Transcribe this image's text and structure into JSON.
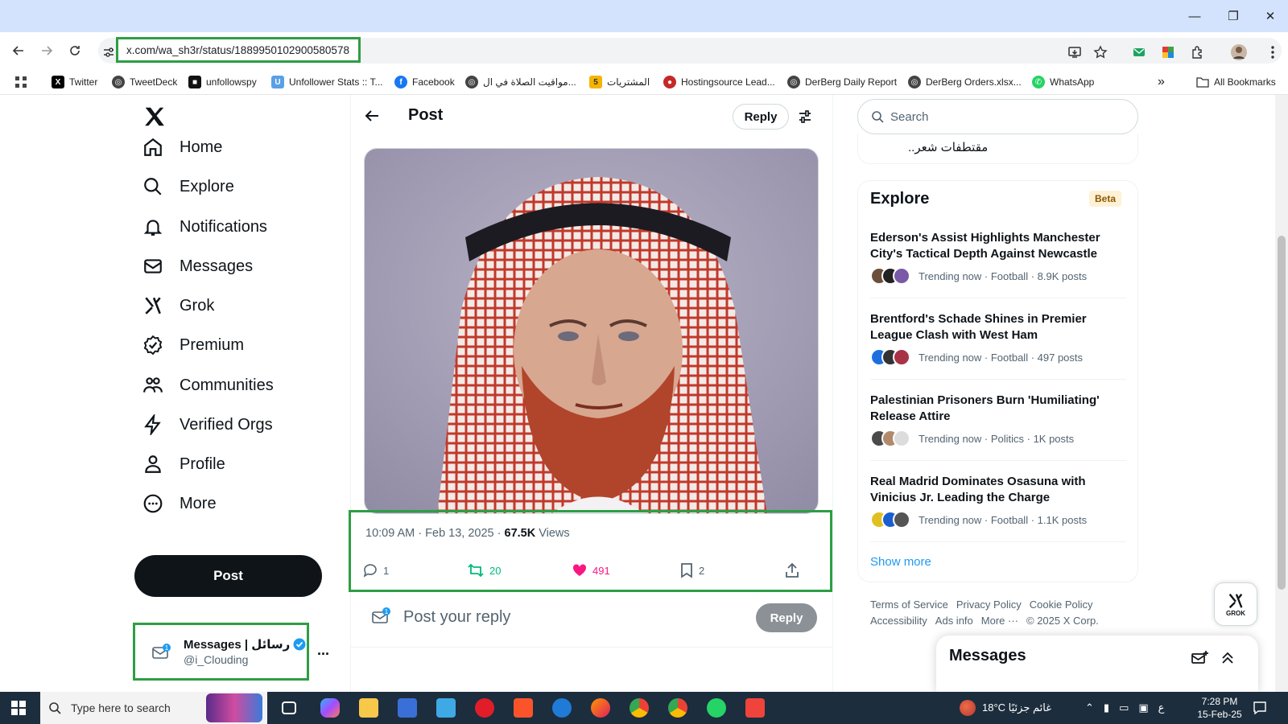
{
  "browser": {
    "url": "x.com/wa_sh3r/status/1889950102900580578",
    "bookmarks": [
      "Twitter",
      "TweetDeck",
      "unfollowspy",
      "Unfollower Stats :: T...",
      "Facebook",
      "مواقيت الصلاة في ال...",
      "المشتريات",
      "Hostingsource Lead...",
      "DerBerg Daily Report",
      "DerBerg Orders.xlsx...",
      "WhatsApp"
    ],
    "all_bookmarks": "All Bookmarks",
    "overflow": "»",
    "window_controls": [
      "minimize-icon",
      "restore-icon",
      "close-icon"
    ]
  },
  "sidebar": {
    "logo": "X",
    "items": [
      {
        "label": "Home",
        "icon": "home-icon"
      },
      {
        "label": "Explore",
        "icon": "search-icon"
      },
      {
        "label": "Notifications",
        "icon": "bell-icon"
      },
      {
        "label": "Messages",
        "icon": "envelope-icon"
      },
      {
        "label": "Grok",
        "icon": "grok-icon"
      },
      {
        "label": "Premium",
        "icon": "verified-badge-icon"
      },
      {
        "label": "Communities",
        "icon": "people-icon"
      },
      {
        "label": "Verified Orgs",
        "icon": "lightning-icon"
      },
      {
        "label": "Profile",
        "icon": "person-icon"
      },
      {
        "label": "More",
        "icon": "more-circle-icon"
      }
    ],
    "post_button": "Post",
    "account": {
      "name": "Messages | رسائل",
      "handle": "@i_Clouding",
      "more": "..."
    }
  },
  "post": {
    "header_title": "Post",
    "reply_pill": "Reply",
    "timestamp": "10:09 AM · Feb 13, 2025 · ",
    "views_count": "67.5K",
    "views_label": " Views",
    "replies": "1",
    "reposts": "20",
    "likes": "491",
    "bookmarks": "2",
    "reply_placeholder": "Post your reply",
    "reply_button": "Reply",
    "liked_color": "#f91880",
    "repost_color": "#00ba7c"
  },
  "right": {
    "search_placeholder": "Search",
    "prev_card_text": "مقتطفات شعر..",
    "explore_title": "Explore",
    "beta": "Beta",
    "trends": [
      {
        "title": "Ederson's Assist Highlights Manchester City's Tactical Depth Against Newcastle",
        "meta": "Trending now · Football · 8.9K posts"
      },
      {
        "title": "Brentford's Schade Shines in Premier League Clash with West Ham",
        "meta": "Trending now · Football · 497 posts"
      },
      {
        "title": "Palestinian Prisoners Burn 'Humiliating' Release Attire",
        "meta": "Trending now · Politics · 1K posts"
      },
      {
        "title": "Real Madrid Dominates Osasuna with Vinicius Jr. Leading the Charge",
        "meta": "Trending now · Football · 1.1K posts"
      }
    ],
    "show_more": "Show more",
    "footer": [
      "Terms of Service",
      "Privacy Policy",
      "Cookie Policy",
      "Accessibility",
      "Ads info",
      "More ···",
      "© 2025 X Corp."
    ],
    "grok_label": "GROK",
    "messages_drawer": "Messages"
  },
  "taskbar": {
    "search_placeholder": "Type here to search",
    "weather": "18°C  غائم جزئيًا",
    "lang": "ع",
    "time": "7:28 PM",
    "date": "15-Feb-25"
  }
}
